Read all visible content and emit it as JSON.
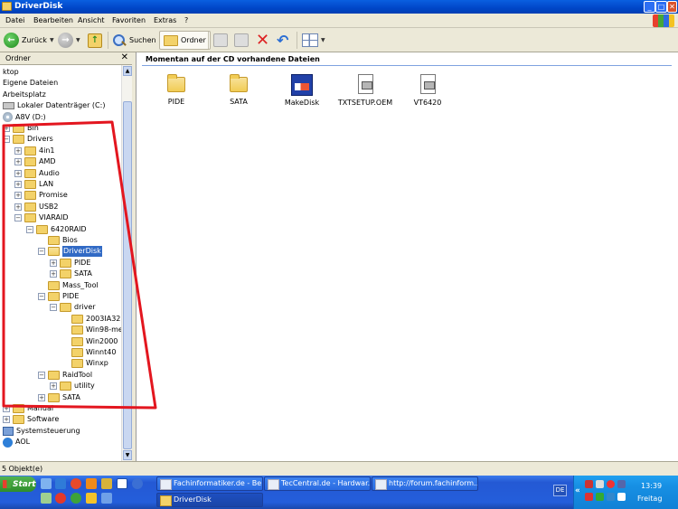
{
  "window": {
    "title": "DriverDisk",
    "btn_min": "_",
    "btn_max": "□",
    "btn_close": "✕"
  },
  "menu": [
    "Datei",
    "Bearbeiten",
    "Ansicht",
    "Favoriten",
    "Extras",
    "?"
  ],
  "toolbar": {
    "back": "Zurück",
    "search": "Suchen",
    "folders": "Ordner"
  },
  "folder_pane": {
    "header": "Ordner",
    "close": "✕",
    "rows": [
      {
        "label": "ktop",
        "indent": 0,
        "pm": "none",
        "icon": "none"
      },
      {
        "label": "Eigene Dateien",
        "indent": 0,
        "pm": "none",
        "icon": "none"
      },
      {
        "label": "Arbeitsplatz",
        "indent": 0,
        "pm": "none",
        "icon": "none"
      },
      {
        "label": "Lokaler Datenträger (C:)",
        "indent": 0,
        "pm": "none",
        "icon": "drive"
      },
      {
        "label": "A8V (D:)",
        "indent": 0,
        "pm": "none",
        "icon": "cd"
      },
      {
        "label": "Bin",
        "indent": 0,
        "pm": "+",
        "icon": "folder"
      },
      {
        "label": "Drivers",
        "indent": 0,
        "pm": "-",
        "icon": "folder"
      },
      {
        "label": "4in1",
        "indent": 1,
        "pm": "+",
        "icon": "folder"
      },
      {
        "label": "AMD",
        "indent": 1,
        "pm": "+",
        "icon": "folder"
      },
      {
        "label": "Audio",
        "indent": 1,
        "pm": "+",
        "icon": "folder"
      },
      {
        "label": "LAN",
        "indent": 1,
        "pm": "+",
        "icon": "folder"
      },
      {
        "label": "Promise",
        "indent": 1,
        "pm": "+",
        "icon": "folder"
      },
      {
        "label": "USB2",
        "indent": 1,
        "pm": "+",
        "icon": "folder"
      },
      {
        "label": "VIARAID",
        "indent": 1,
        "pm": "-",
        "icon": "folder"
      },
      {
        "label": "6420RAID",
        "indent": 2,
        "pm": "-",
        "icon": "folder"
      },
      {
        "label": "Bios",
        "indent": 3,
        "pm": "none",
        "icon": "folder"
      },
      {
        "label": "DriverDisk",
        "indent": 3,
        "pm": "-",
        "icon": "folder-open",
        "selected": true
      },
      {
        "label": "PIDE",
        "indent": 4,
        "pm": "+",
        "icon": "folder"
      },
      {
        "label": "SATA",
        "indent": 4,
        "pm": "+",
        "icon": "folder"
      },
      {
        "label": "Mass_Tool",
        "indent": 3,
        "pm": "none",
        "icon": "folder"
      },
      {
        "label": "PIDE",
        "indent": 3,
        "pm": "-",
        "icon": "folder"
      },
      {
        "label": "driver",
        "indent": 4,
        "pm": "-",
        "icon": "folder"
      },
      {
        "label": "2003IA32",
        "indent": 5,
        "pm": "none",
        "icon": "folder"
      },
      {
        "label": "Win98-me",
        "indent": 5,
        "pm": "none",
        "icon": "folder"
      },
      {
        "label": "Win2000",
        "indent": 5,
        "pm": "none",
        "icon": "folder"
      },
      {
        "label": "Winnt40",
        "indent": 5,
        "pm": "none",
        "icon": "folder"
      },
      {
        "label": "Winxp",
        "indent": 5,
        "pm": "none",
        "icon": "folder"
      },
      {
        "label": "RaidTool",
        "indent": 3,
        "pm": "-",
        "icon": "folder"
      },
      {
        "label": "utility",
        "indent": 4,
        "pm": "+",
        "icon": "folder"
      },
      {
        "label": "SATA",
        "indent": 3,
        "pm": "+",
        "icon": "folder"
      },
      {
        "label": "Manual",
        "indent": 0,
        "pm": "+",
        "icon": "folder"
      },
      {
        "label": "Software",
        "indent": 0,
        "pm": "+",
        "icon": "folder"
      },
      {
        "label": "Systemsteuerung",
        "indent": 0,
        "pm": "none",
        "icon": "controlpanel"
      },
      {
        "label": "AOL",
        "indent": 0,
        "pm": "none",
        "icon": "aol"
      }
    ]
  },
  "content": {
    "heading": "Momentan auf der CD vorhandene Dateien",
    "files": [
      {
        "name": "PIDE",
        "type": "folder"
      },
      {
        "name": "SATA",
        "type": "folder"
      },
      {
        "name": "MakeDisk",
        "type": "exe"
      },
      {
        "name": "TXTSETUP.OEM",
        "type": "doc"
      },
      {
        "name": "VT6420",
        "type": "doc"
      }
    ]
  },
  "status": {
    "text": "5 Objekt(e)"
  },
  "taskbar": {
    "start": "Start",
    "tasks": [
      {
        "label": "Fachinformatiker.de - Bei...",
        "active": false
      },
      {
        "label": "TecCentral.de - Hardwar...",
        "active": false
      },
      {
        "label": "http://forum.fachinform...",
        "active": false
      },
      {
        "label": "DriverDisk",
        "active": true
      }
    ],
    "lang": "DE",
    "chevron": "«",
    "clock": "13:39",
    "day": "Freitag"
  },
  "colors": {
    "highlight_box": "#e3161f",
    "selection": "#316ac5",
    "title_bar": "#0a5fe0"
  }
}
